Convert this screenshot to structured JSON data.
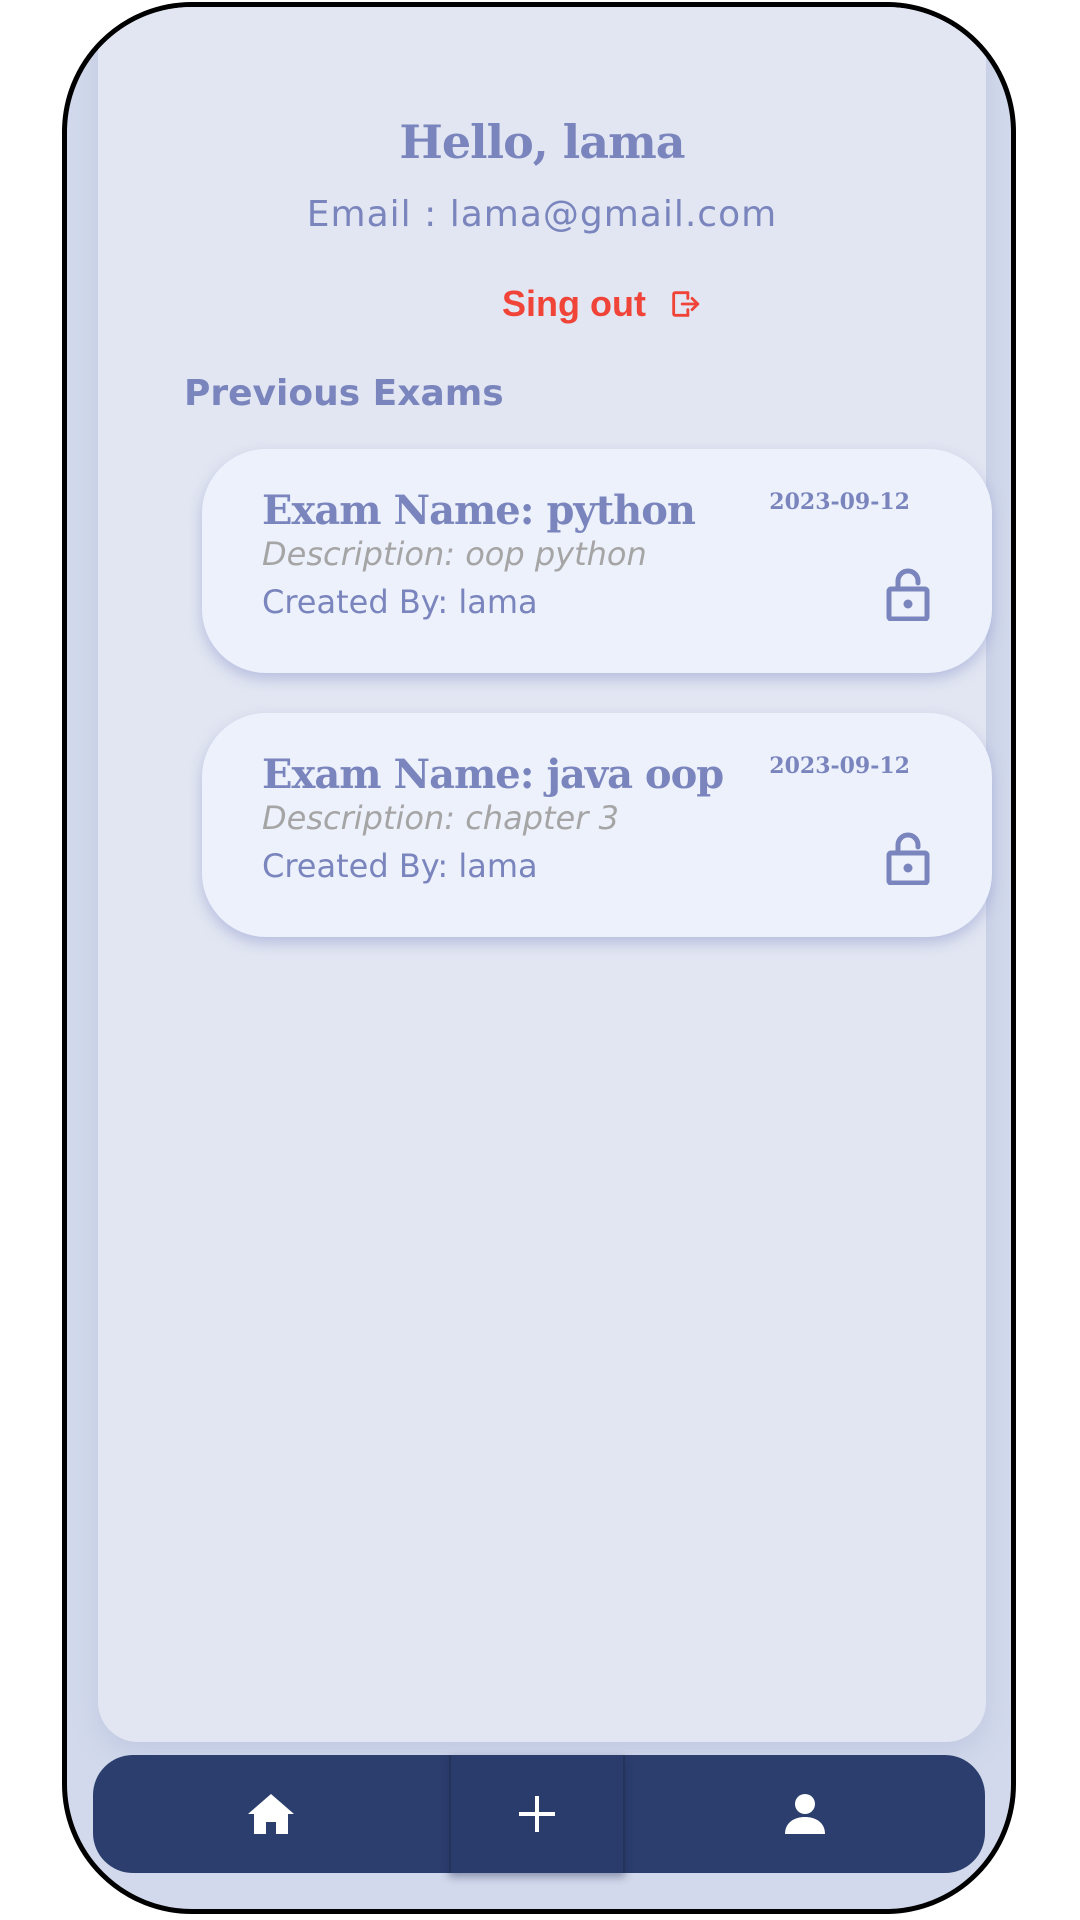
{
  "header": {
    "greeting": "Hello, lama",
    "email": "Email : lama@gmail.com"
  },
  "signout": {
    "label": "Sing out",
    "icon": "logout-icon",
    "color": "#f04438"
  },
  "exams_section": {
    "title": "Previous Exams",
    "items": [
      {
        "name": "Exam Name: python",
        "description": "Description: oop python",
        "created_by": "Created By: lama",
        "date": "2023-09-12",
        "icon": "lock-icon"
      },
      {
        "name": "Exam Name: java oop",
        "description": "Description: chapter 3",
        "created_by": "Created By: lama",
        "date": "2023-09-12",
        "icon": "lock-icon"
      }
    ]
  },
  "bottom_nav": {
    "items": [
      {
        "icon": "home-icon"
      },
      {
        "icon": "plus-icon"
      },
      {
        "icon": "person-icon"
      }
    ],
    "background": "#2c3e6e"
  },
  "colors": {
    "accent": "#7a85bd",
    "screen_background": "#e2e6f2",
    "card_background": "#edf1fc",
    "muted_text": "#a5a5a5"
  }
}
